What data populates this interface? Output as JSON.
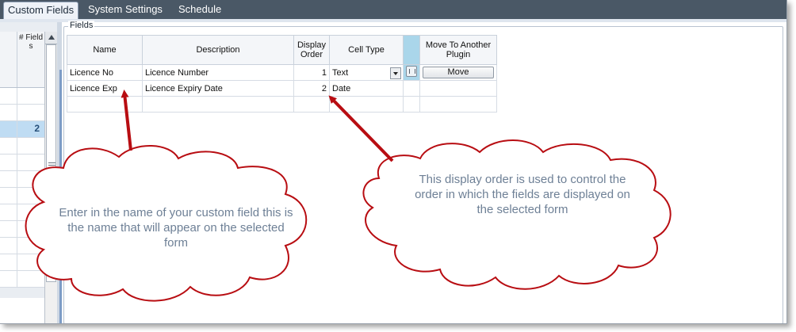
{
  "tabs": [
    {
      "label": "Custom Fields",
      "active": true
    },
    {
      "label": "System Settings",
      "active": false
    },
    {
      "label": "Schedule",
      "active": false
    }
  ],
  "left_grid": {
    "header": "# Field s",
    "selected_value": "2"
  },
  "fields_group": {
    "legend": "Fields",
    "columns": [
      "Name",
      "Description",
      "Display Order",
      "Cell Type",
      "",
      "Move To Another Plugin"
    ],
    "rows": [
      {
        "name": "Licence No",
        "description": "Licence Number",
        "display_order": "1",
        "cell_type": "Text",
        "move_label": "Move"
      },
      {
        "name": "Licence Exp",
        "description": "Licence Expiry Date",
        "display_order": "2",
        "cell_type": "Date",
        "move_label": ""
      },
      {
        "name": "",
        "description": "",
        "display_order": "",
        "cell_type": "",
        "move_label": ""
      }
    ]
  },
  "callouts": {
    "left": "Enter in the name of your custom field this is the name that will appear on the selected form",
    "right": "This display order is used to control the order in which the fields are displayed on the selected form"
  },
  "colors": {
    "tab_bar": "#4a5866",
    "selected_row": "#bfdcf3",
    "callout_border": "#b80d12",
    "callout_text": "#6e8096",
    "arrow": "#b80d12"
  }
}
